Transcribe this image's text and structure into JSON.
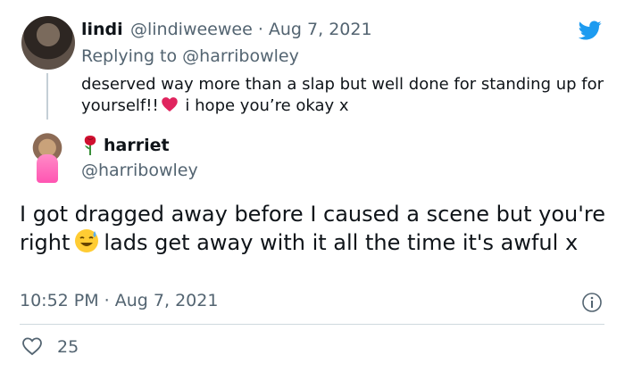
{
  "reply_tweet": {
    "display_name": "lindi",
    "handle_date": "@lindiweewee · Aug 7, 2021",
    "replying_to_prefix": "Replying to ",
    "replying_to_handle": "@harribowley",
    "text_part1": "deserved way more than a slap but well done for standing up for yourself!!",
    "text_part2": " i hope you’re okay x"
  },
  "main_tweet": {
    "display_name": "harriet",
    "handle": "@harribowley",
    "text_part1": "I got dragged away before I caused a scene but you're right",
    "text_part2": "lads get away with it all the time it's awful x",
    "timestamp": "10:52 PM · Aug 7, 2021",
    "like_count": "25"
  },
  "colors": {
    "accent": "#1d9bf0",
    "muted": "#536471",
    "heart": "#e0245e"
  },
  "icons": [
    "twitter-logo-icon",
    "rose-emoji-icon",
    "red-heart-emoji-icon",
    "sweat-smile-emoji-icon",
    "info-icon",
    "like-heart-icon"
  ]
}
